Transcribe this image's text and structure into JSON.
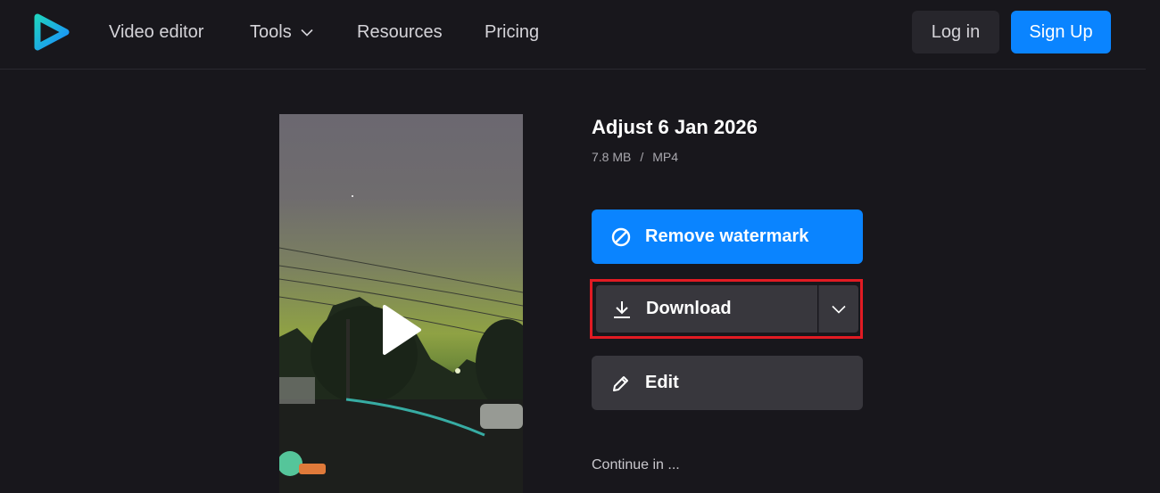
{
  "header": {
    "logo_icon": "play-logo-icon",
    "nav": {
      "video_editor": "Video editor",
      "tools": "Tools",
      "resources": "Resources",
      "pricing": "Pricing"
    },
    "login_label": "Log in",
    "signup_label": "Sign Up"
  },
  "file": {
    "title": "Adjust 6 Jan 2026",
    "size": "7.8 MB",
    "separator": "/",
    "format": "MP4"
  },
  "actions": {
    "remove_watermark": "Remove watermark",
    "download": "Download",
    "edit": "Edit"
  },
  "continue_label": "Continue in ...",
  "colors": {
    "background": "#18171c",
    "accent": "#0a84ff",
    "button_dark": "#38373d",
    "highlight_border": "#e11b23"
  }
}
